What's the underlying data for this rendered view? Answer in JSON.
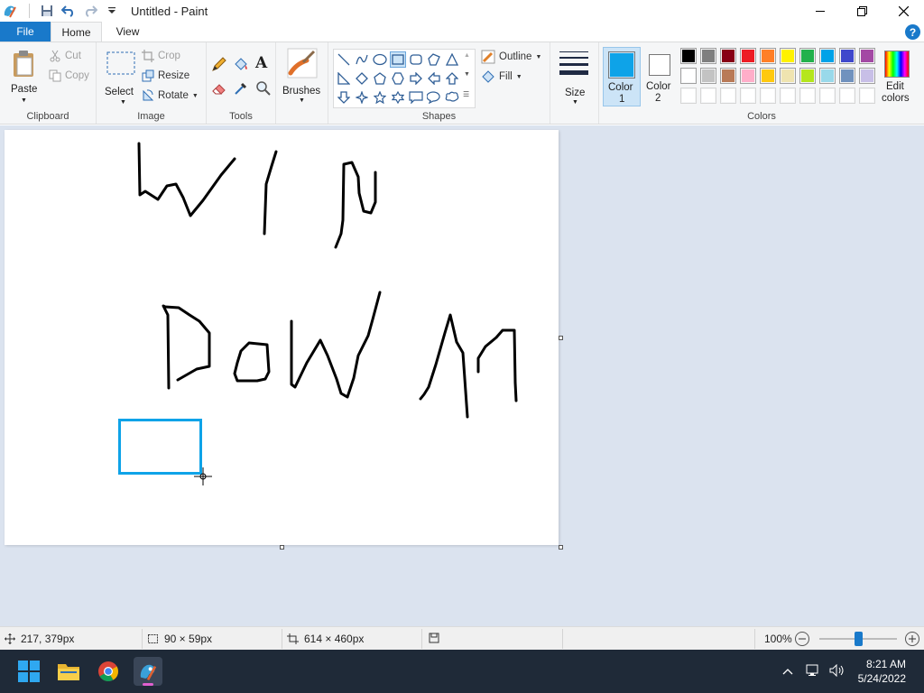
{
  "window": {
    "title": "Untitled - Paint"
  },
  "tabs": {
    "file": "File",
    "home": "Home",
    "view": "View"
  },
  "ribbon": {
    "clipboard": {
      "label": "Clipboard",
      "paste": "Paste",
      "cut": "Cut",
      "copy": "Copy"
    },
    "image": {
      "label": "Image",
      "select": "Select",
      "crop": "Crop",
      "resize": "Resize",
      "rotate": "Rotate"
    },
    "tools": {
      "label": "Tools"
    },
    "brushes": {
      "label": "Brushes"
    },
    "shapes": {
      "label": "Shapes",
      "outline": "Outline",
      "fill": "Fill"
    },
    "size": {
      "label": "Size"
    },
    "colors": {
      "label": "Colors",
      "color1_label": "Color",
      "color1_num": "1",
      "color2_label": "Color",
      "color2_num": "2",
      "edit_label": "Edit",
      "edit_label2": "colors",
      "color1": "#0ea3e8",
      "color2": "#ffffff",
      "palette_row1": [
        "#000000",
        "#7f7f7f",
        "#880015",
        "#ed1c24",
        "#ff7f27",
        "#fff200",
        "#22b14c",
        "#00a2e8",
        "#3f48cc",
        "#a349a4"
      ],
      "palette_row2": [
        "#ffffff",
        "#c3c3c3",
        "#b97a57",
        "#ffaec9",
        "#ffc90e",
        "#efe4b0",
        "#b5e61d",
        "#99d9ea",
        "#7092be",
        "#c8bfe7"
      ]
    }
  },
  "status": {
    "cursor_pos": "217, 379px",
    "selection_size": "90 × 59px",
    "canvas_size": "614 × 460px",
    "zoom": "100%",
    "zoom_level": 0.5
  },
  "taskbar": {
    "time": "8:21 AM",
    "date": "5/24/2022"
  }
}
